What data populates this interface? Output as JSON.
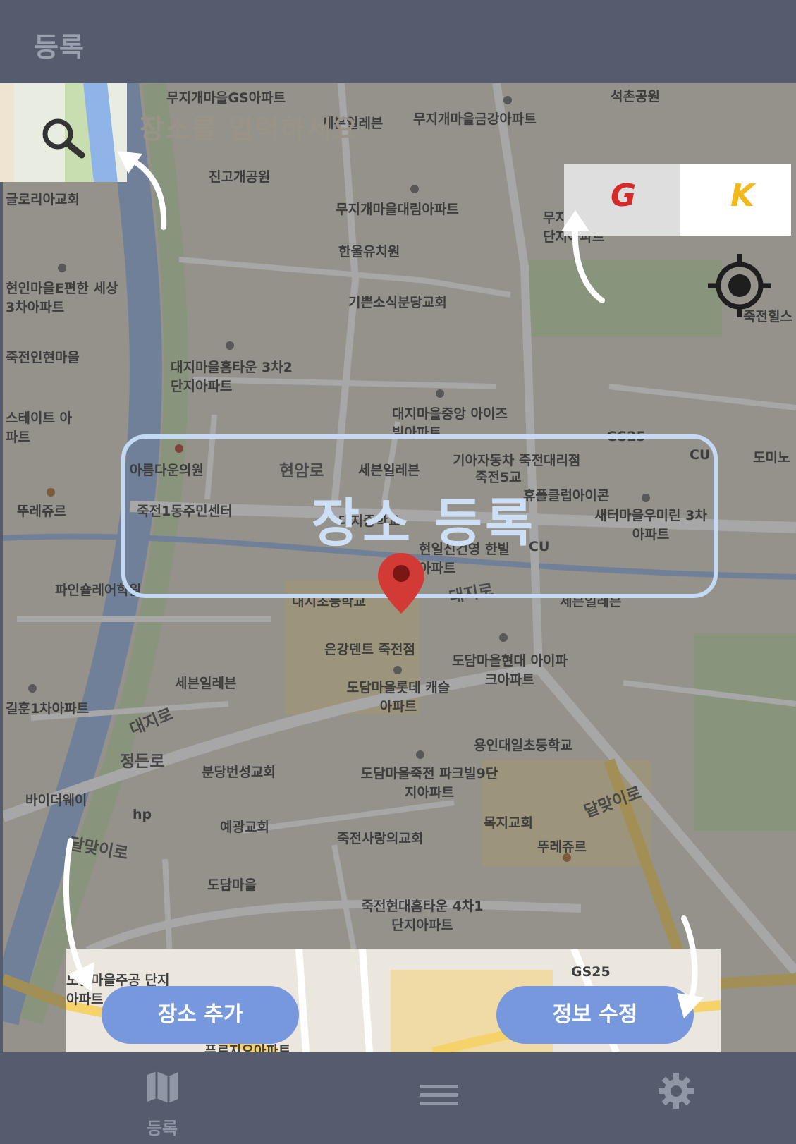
{
  "header": {
    "title": "등록"
  },
  "search": {
    "placeholder": "장소를 입력하세요"
  },
  "gk": {
    "left_label": "G",
    "right_label": "K"
  },
  "map": {
    "labels": [
      "무지개마을GS아파트",
      "세븐일레븐",
      "무지개마을금강아파트",
      "석촌공원",
      "진고개공원",
      "글로리아교회",
      "무지개마을대림아파트",
      "한울유치원",
      "무지개뜨란채 12단지아파트",
      "현인마을E편한 세상3차아파트",
      "기쁜소식분당교회",
      "죽전힐스",
      "죽전인현마을",
      "대지마을홈타운 3차2단지아파트",
      "스테이트 아파트",
      "대지마을중앙 아이즈빌아파트",
      "GS25",
      "CU",
      "도미노",
      "현암로",
      "아름다운의원",
      "세븐일레븐",
      "기아자동차 죽전대리점",
      "죽전1동주민센터",
      "뚜레쥬르",
      "죽전5교",
      "대지중학교",
      "휴플클럽아이콘",
      "새터마을우미린 3차아파트",
      "현일신건영 한빌아파트",
      "CU",
      "파인숄레어학원",
      "대지초등학교",
      "대지로",
      "세븐일레븐",
      "은강덴트 죽전점",
      "도담마을현대 아이파크아파트",
      "세븐일레븐",
      "도담마을롯데 캐슬아파트",
      "길훈1차아파트",
      "대지로",
      "용인대일초등학교",
      "정든로",
      "분당번성교회",
      "도담마을죽전 파크빌9단지아파트",
      "바이더웨이",
      "hp",
      "예광교회",
      "달맞이로",
      "목지교회",
      "뚜레쥬르",
      "달맞이로",
      "죽전사랑의교회",
      "도담마을",
      "죽전현대홈타운 4차1단지아파트",
      "도담마을주공 단지아파트",
      "GS25",
      "푸르지오아파트"
    ]
  },
  "center": {
    "register_label": "장소 등록"
  },
  "buttons": {
    "add_label": "장소 추가",
    "edit_label": "정보 수정"
  },
  "tabbar": {
    "map_label": "등록"
  }
}
